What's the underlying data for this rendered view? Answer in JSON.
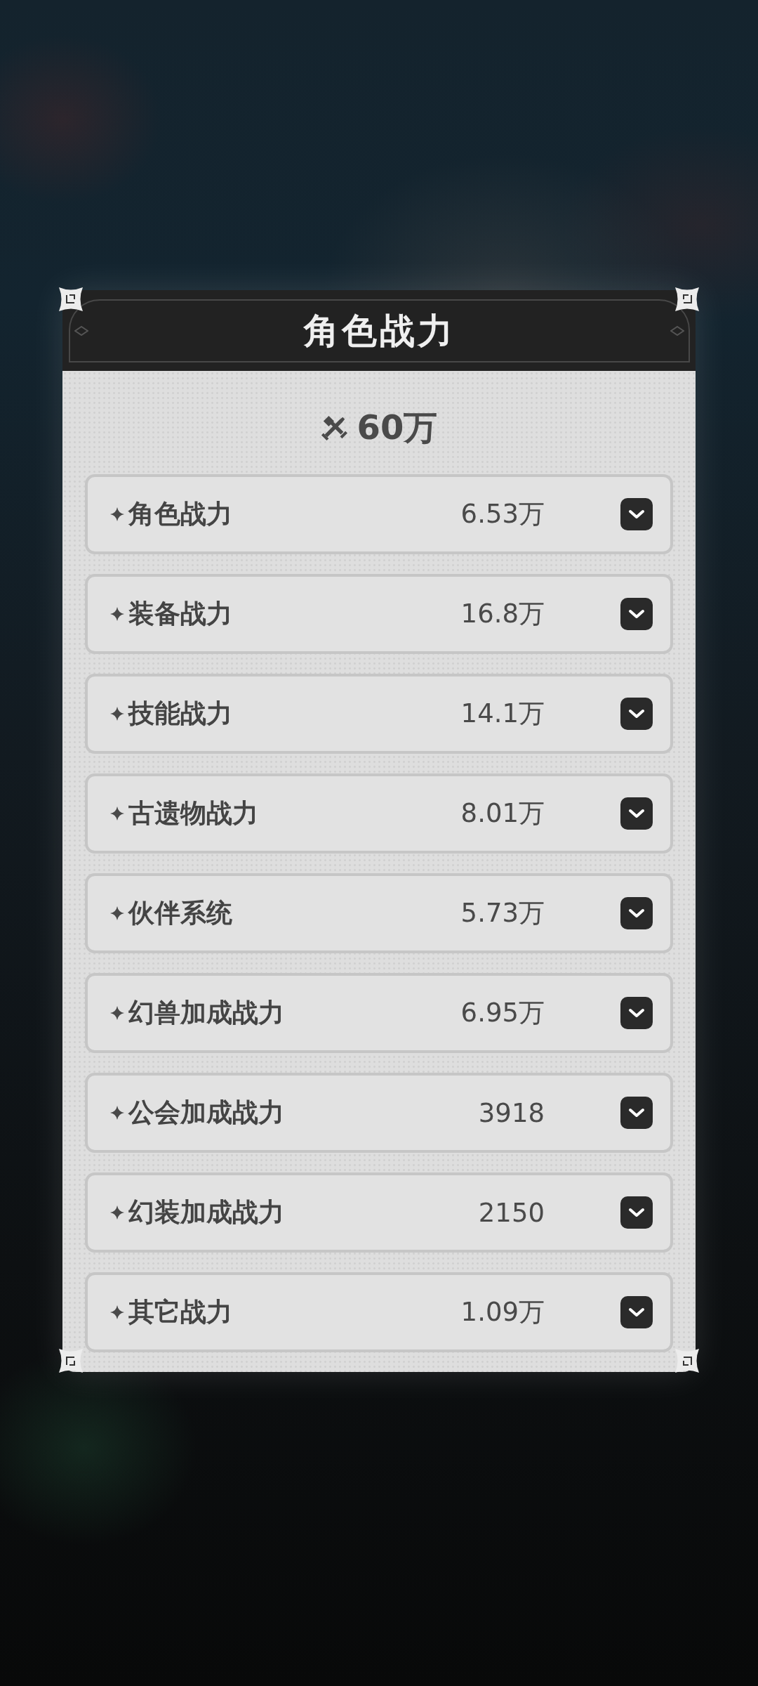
{
  "dialog": {
    "title": "角色战力"
  },
  "total": {
    "value": "60万"
  },
  "rows": [
    {
      "label": "角色战力",
      "value": "6.53万",
      "expanded": false
    },
    {
      "label": "装备战力",
      "value": "16.8万",
      "expanded": false
    },
    {
      "label": "技能战力",
      "value": "14.1万",
      "expanded": false
    },
    {
      "label": "古遗物战力",
      "value": "8.01万",
      "expanded": false
    },
    {
      "label": "伙伴系统",
      "value": "5.73万",
      "expanded": false
    },
    {
      "label": "幻兽加成战力",
      "value": "6.95万",
      "expanded": false
    },
    {
      "label": "公会加成战力",
      "value": "3918",
      "expanded": false
    },
    {
      "label": "幻装加成战力",
      "value": "2150",
      "expanded": false
    },
    {
      "label": "其它战力",
      "value": "1.09万",
      "expanded": false
    }
  ]
}
